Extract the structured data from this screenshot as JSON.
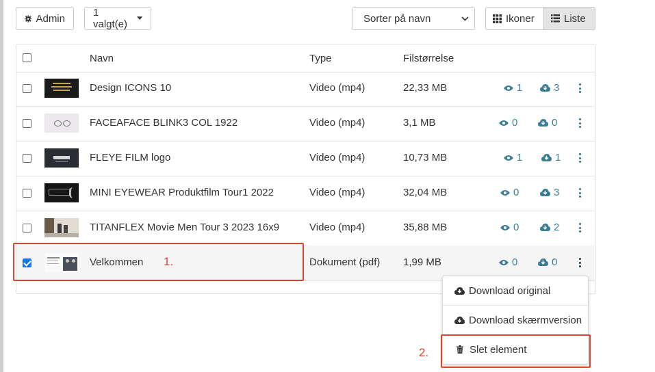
{
  "toolbar": {
    "admin_label": "Admin",
    "selected_label": "1 valgt(e)",
    "sort_value": "Sorter på navn",
    "view_icons_label": "Ikoner",
    "view_list_label": "Liste"
  },
  "table": {
    "headers": {
      "name": "Navn",
      "type": "Type",
      "size": "Filstørrelse"
    },
    "rows": [
      {
        "name": "Design ICONS 10",
        "type": "Video (mp4)",
        "size": "22,33 MB",
        "views": "1",
        "downloads": "3",
        "checked": false
      },
      {
        "name": "FACEAFACE BLINK3 COL 1922",
        "type": "Video (mp4)",
        "size": "3,1 MB",
        "views": "0",
        "downloads": "0",
        "checked": false
      },
      {
        "name": "FLEYE FILM logo",
        "type": "Video (mp4)",
        "size": "10,73 MB",
        "views": "1",
        "downloads": "1",
        "checked": false
      },
      {
        "name": "MINI EYEWEAR Produktfilm Tour1 2022",
        "type": "Video (mp4)",
        "size": "32,04 MB",
        "views": "0",
        "downloads": "3",
        "checked": false
      },
      {
        "name": "TITANFLEX Movie Men Tour 3 2023 16x9",
        "type": "Video (mp4)",
        "size": "35,88 MB",
        "views": "0",
        "downloads": "2",
        "checked": false
      },
      {
        "name": "Velkommen",
        "type": "Dokument (pdf)",
        "size": "1,99 MB",
        "views": "0",
        "downloads": "0",
        "checked": true
      }
    ]
  },
  "context_menu": {
    "download_original": "Download original",
    "download_screen": "Download skærmversion",
    "delete": "Slet element"
  },
  "annotations": {
    "step1": "1.",
    "step2": "2."
  },
  "colors": {
    "accent": "#3a7d94",
    "annotation": "#d9452f",
    "checkbox": "#1a73e8"
  }
}
